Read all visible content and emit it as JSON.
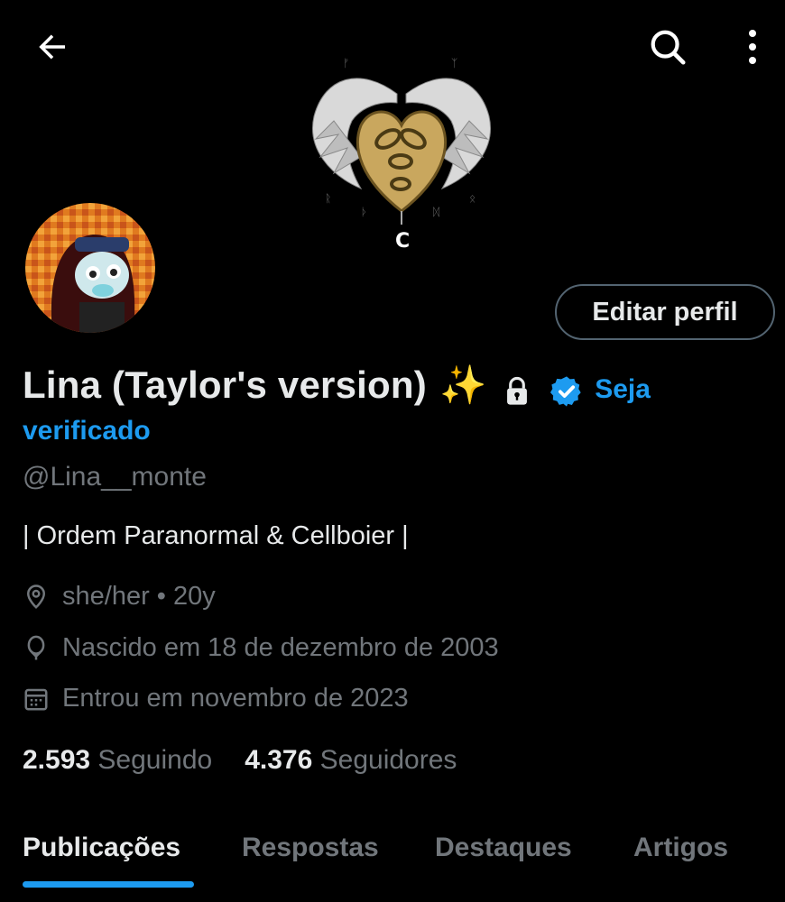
{
  "header": {
    "back_icon": "arrow-left-icon",
    "search_icon": "search-icon",
    "more_icon": "more-vertical-icon"
  },
  "profile": {
    "name": "Lina (Taylor's version)",
    "name_emoji": "✨",
    "verify_cta_line1": "Seja",
    "verify_cta_line2": "verificado",
    "handle": "@Lina__monte",
    "bio": "| Ordem Paranormal & Cellboier |",
    "edit_button": "Editar perfil",
    "banner_letter": "C"
  },
  "meta": {
    "pronouns": "she/her • 20y",
    "born": "Nascido em 18 de dezembro de 2003",
    "joined": "Entrou em novembro de 2023"
  },
  "stats": {
    "following_count": "2.593",
    "following_label": "Seguindo",
    "followers_count": "4.376",
    "followers_label": "Seguidores"
  },
  "tabs": [
    {
      "label": "Publicações",
      "active": true
    },
    {
      "label": "Respostas",
      "active": false
    },
    {
      "label": "Destaques",
      "active": false
    },
    {
      "label": "Artigos",
      "active": false
    }
  ],
  "colors": {
    "accent": "#1d9bf0",
    "text_primary": "#e7e9ea",
    "text_secondary": "#71767b",
    "background": "#000000"
  }
}
